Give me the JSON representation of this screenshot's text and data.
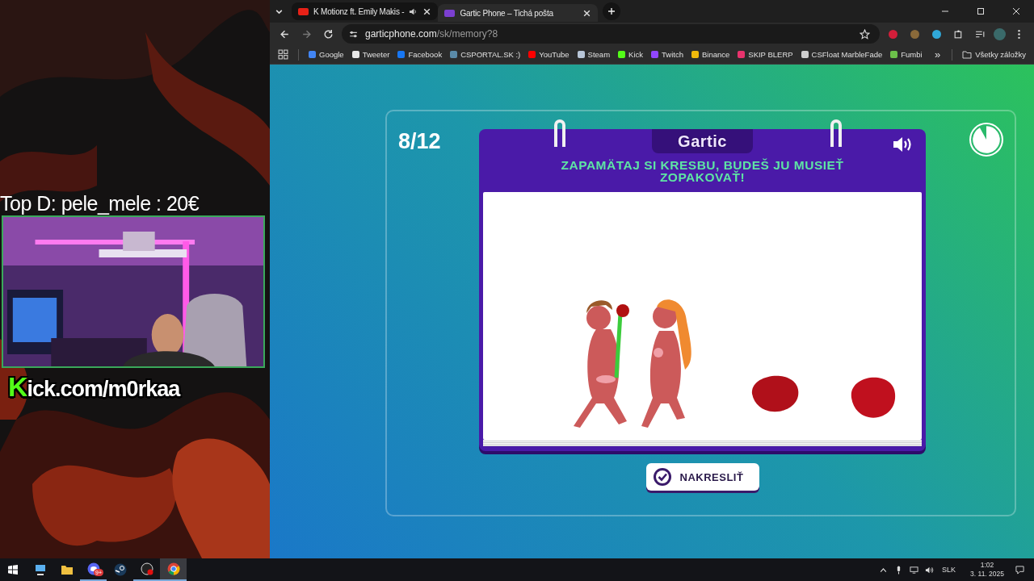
{
  "stream_overlay": {
    "top_donation": "Top D: pele_mele : 20€",
    "channel_link": "Kick.com/m0rkaa"
  },
  "browser": {
    "tabs": [
      {
        "title": "K Motionz ft. Emily Makis -",
        "audio": true,
        "selected": false,
        "color": "#e62117"
      },
      {
        "title": "Gartic Phone – Tichá pošta",
        "audio": false,
        "selected": true,
        "color": "#7b3fd0"
      }
    ],
    "address": {
      "host": "garticphone.com",
      "path": "/sk/memory?8"
    },
    "bookmarks": [
      {
        "label": "Google",
        "color": "#4285f4"
      },
      {
        "label": "Tweeter",
        "color": "#e8e8e8"
      },
      {
        "label": "Facebook",
        "color": "#1877f2"
      },
      {
        "label": "CSPORTAL.SK :)",
        "color": "#5a8aa8"
      },
      {
        "label": "YouTube",
        "color": "#ff0000"
      },
      {
        "label": "Steam",
        "color": "#b8c6d8"
      },
      {
        "label": "Kick",
        "color": "#53fc18"
      },
      {
        "label": "Twitch",
        "color": "#9146ff"
      },
      {
        "label": "Binance",
        "color": "#f0b90b"
      },
      {
        "label": "SKIP BLERP",
        "color": "#e8336d"
      },
      {
        "label": "CSFloat MarbleFade",
        "color": "#cfcfcf"
      },
      {
        "label": "Fumbi",
        "color": "#6cc04a"
      }
    ],
    "more_bookmarks": "»",
    "all_bookmarks": "Všetky záložky"
  },
  "game": {
    "round": "8/12",
    "logo": "Gartic",
    "instruction": "ZAPAMÄTAJ SI KRESBU, BUDEŠ JU MUSIEŤ ZOPAKOVAŤ!",
    "button": "NAKRESLIŤ",
    "timer": {
      "level": 0.92
    }
  },
  "taskbar": {
    "apps": [
      {
        "kind": "pc",
        "running": false,
        "selected": false
      },
      {
        "kind": "folder",
        "running": false,
        "selected": false
      },
      {
        "kind": "discord",
        "running": true,
        "selected": false,
        "badge": "9+"
      },
      {
        "kind": "steam",
        "running": false,
        "selected": false
      },
      {
        "kind": "obs",
        "running": true,
        "selected": false
      },
      {
        "kind": "chrome",
        "running": true,
        "selected": true
      }
    ],
    "language": "SLK",
    "time": "1:02",
    "date": "3. 11. 2025"
  }
}
